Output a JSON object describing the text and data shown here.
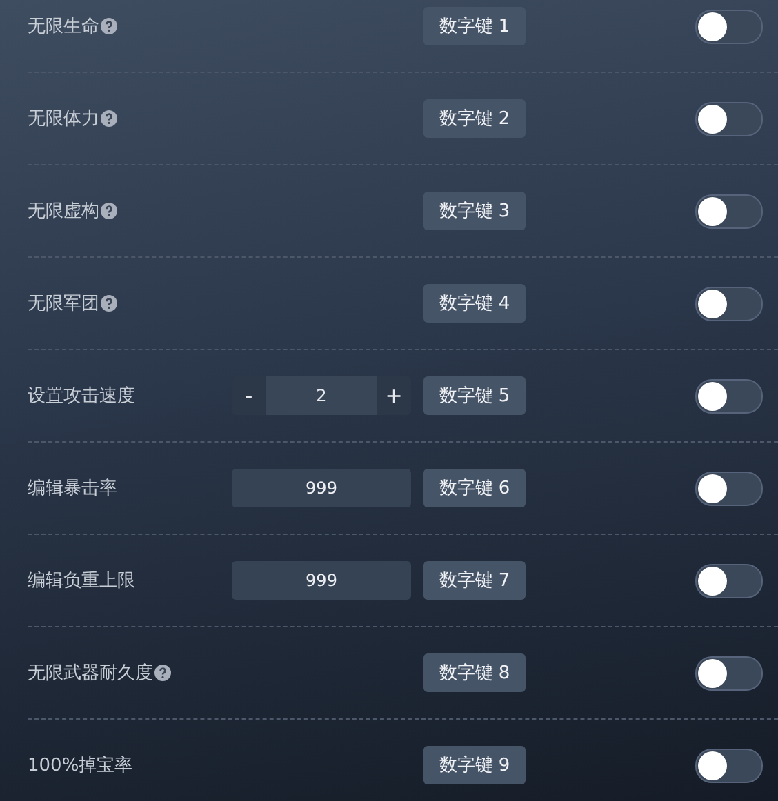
{
  "options": [
    {
      "label": "无限生命",
      "help": true,
      "kind": "plain",
      "hotkey": "数字键 1",
      "on": false
    },
    {
      "label": "无限体力",
      "help": true,
      "kind": "plain",
      "hotkey": "数字键 2",
      "on": false
    },
    {
      "label": "无限虚构",
      "help": true,
      "kind": "plain",
      "hotkey": "数字键 3",
      "on": false
    },
    {
      "label": "无限军团",
      "help": true,
      "kind": "plain",
      "hotkey": "数字键 4",
      "on": false
    },
    {
      "label": "设置攻击速度",
      "help": false,
      "kind": "stepper",
      "minus": "-",
      "value": "2",
      "plus": "+",
      "hotkey": "数字键 5",
      "on": false
    },
    {
      "label": "编辑暴击率",
      "help": false,
      "kind": "input",
      "value": "999",
      "hotkey": "数字键 6",
      "on": false
    },
    {
      "label": "编辑负重上限",
      "help": false,
      "kind": "input",
      "value": "999",
      "hotkey": "数字键 7",
      "on": false
    },
    {
      "label": "无限武器耐久度",
      "help": true,
      "kind": "plain",
      "hotkey": "数字键 8",
      "on": false
    },
    {
      "label": "100%掉宝率",
      "help": false,
      "kind": "plain",
      "hotkey": "数字键 9",
      "on": false
    }
  ]
}
